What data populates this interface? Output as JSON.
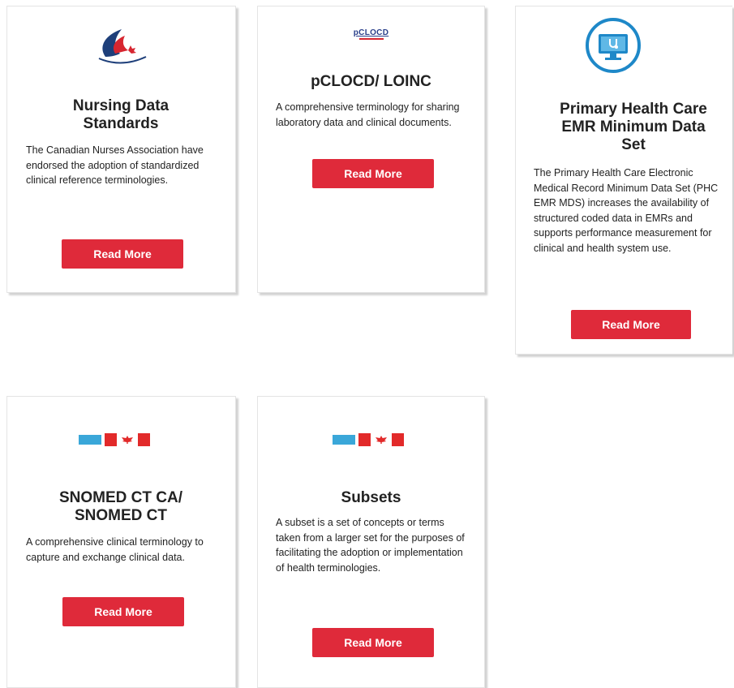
{
  "cards": [
    {
      "title": "Nursing Data Standards",
      "description": "The Canadian Nurses Association have endorsed the adoption of standardized clinical reference terminologies.",
      "button": "Read More",
      "logo": "flame-logo-icon"
    },
    {
      "title": "pCLOCD/ LOINC",
      "description": "A comprehensive terminology for sharing laboratory data and clinical documents.",
      "button": "Read More",
      "logo_text": "pCLOCD"
    },
    {
      "title": "Primary Health Care EMR Minimum Data Set",
      "description": "The Primary Health Care Electronic Medical Record Minimum Data Set (PHC EMR MDS) increases the availability of structured coded data in EMRs and supports performance measurement for clinical and health system use.",
      "button": "Read More",
      "logo": "monitor-stethoscope-icon"
    },
    {
      "title": "SNOMED CT CA/ SNOMED CT",
      "description": "A comprehensive clinical terminology to capture and exchange clinical data.",
      "button": "Read More",
      "logo": "canada-flag-icon"
    },
    {
      "title": "Subsets",
      "description": "A subset is a set of concepts or terms taken from a larger set for the purposes of facilitating the adoption or implementation of health terminologies.",
      "button": "Read More",
      "logo": "canada-flag-icon"
    }
  ],
  "colors": {
    "button": "#df2a3a",
    "icon_blue": "#1e88c8",
    "accent_red": "#e22a2a"
  }
}
